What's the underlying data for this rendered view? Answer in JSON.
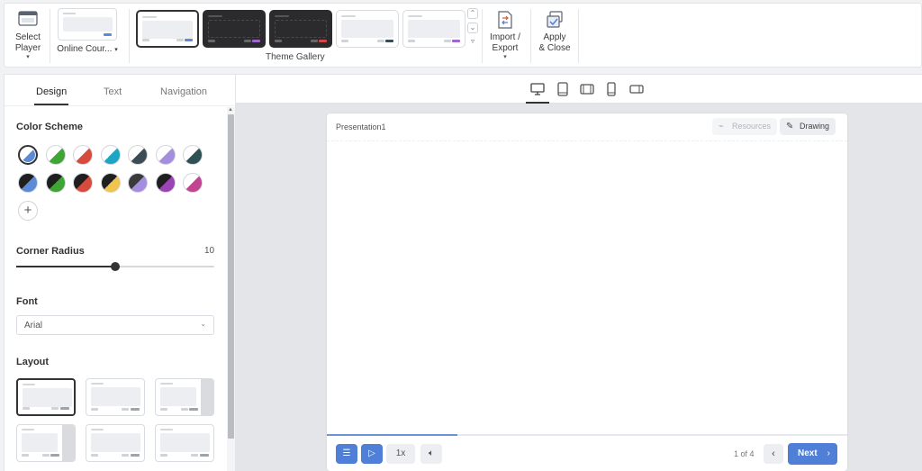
{
  "ribbon": {
    "select_player": {
      "line1": "Select",
      "line2": "Player",
      "icon": "player-window-icon"
    },
    "player_dropdown": {
      "label": "Online Cour...",
      "icon": "caret-down-icon"
    },
    "theme_gallery_label": "Theme Gallery",
    "themes": [
      {
        "name": "light-blue",
        "style": "light",
        "accent": "#5b8ad6",
        "selected": true
      },
      {
        "name": "dark-purple",
        "style": "dark",
        "accent": "#a066d0",
        "selected": false
      },
      {
        "name": "dark-red",
        "style": "dark",
        "accent": "#d24848",
        "selected": false
      },
      {
        "name": "light-slate",
        "style": "light",
        "accent": "#3b4c55",
        "selected": false
      },
      {
        "name": "light-violet",
        "style": "light",
        "accent": "#a066d0",
        "selected": false
      }
    ],
    "import_export": {
      "line1": "Import /",
      "line2": "Export",
      "icon": "import-export-icon"
    },
    "apply_close": {
      "line1": "Apply",
      "line2": "& Close",
      "icon": "apply-close-icon"
    }
  },
  "panel": {
    "tabs": [
      {
        "label": "Design",
        "active": true
      },
      {
        "label": "Text",
        "active": false
      },
      {
        "label": "Navigation",
        "active": false
      }
    ],
    "color_scheme": {
      "title": "Color Scheme",
      "swatches": [
        {
          "base": "#ffffff",
          "accent": "#5b8ad6",
          "selected": true
        },
        {
          "base": "#ffffff",
          "accent": "#3fa535",
          "selected": false
        },
        {
          "base": "#ffffff",
          "accent": "#d84a3b",
          "selected": false
        },
        {
          "base": "#ffffff",
          "accent": "#1ca6c4",
          "selected": false
        },
        {
          "base": "#ffffff",
          "accent": "#3b4c55",
          "selected": false
        },
        {
          "base": "#ffffff",
          "accent": "#a58de0",
          "selected": false
        },
        {
          "base": "#ffffff",
          "accent": "#2e5156",
          "selected": false
        },
        {
          "base": "#1f1f20",
          "accent": "#5b8ad6",
          "selected": false
        },
        {
          "base": "#1f1f20",
          "accent": "#3fa535",
          "selected": false
        },
        {
          "base": "#1f1f20",
          "accent": "#d84a3b",
          "selected": false
        },
        {
          "base": "#1f1f20",
          "accent": "#f0c44d",
          "selected": false
        },
        {
          "base": "#3a3a3c",
          "accent": "#a58de0",
          "selected": false
        },
        {
          "base": "#1f1f20",
          "accent": "#9b44b5",
          "selected": false
        },
        {
          "base": "#ffffff",
          "accent": "#c0448f",
          "selected": false
        }
      ],
      "add_icon": "plus-icon"
    },
    "corner_radius": {
      "title": "Corner Radius",
      "value": "10",
      "level": 0.5
    },
    "font": {
      "title": "Font",
      "value": "Arial"
    },
    "layout": {
      "title": "Layout",
      "options": [
        {
          "variant": "standard",
          "selected": true
        },
        {
          "variant": "standard",
          "selected": false
        },
        {
          "variant": "sidebar-right",
          "selected": false
        },
        {
          "variant": "sidebar-right",
          "selected": false
        },
        {
          "variant": "standard",
          "selected": false
        },
        {
          "variant": "standard",
          "selected": false
        }
      ]
    }
  },
  "preview": {
    "devices": [
      "desktop-icon",
      "tablet-portrait-icon",
      "tablet-landscape-icon",
      "phone-portrait-icon",
      "phone-landscape-icon"
    ],
    "slide": {
      "title": "Presentation1",
      "resources_label": "Resources",
      "drawing_label": "Drawing",
      "progress": 0.25,
      "speed": "1x",
      "page_indicator": "1 of 4",
      "next_label": "Next"
    }
  },
  "colors": {
    "accent": "#4f7fd6",
    "panel_bg": "#ffffff",
    "canvas_bg": "#e4e5e8"
  }
}
